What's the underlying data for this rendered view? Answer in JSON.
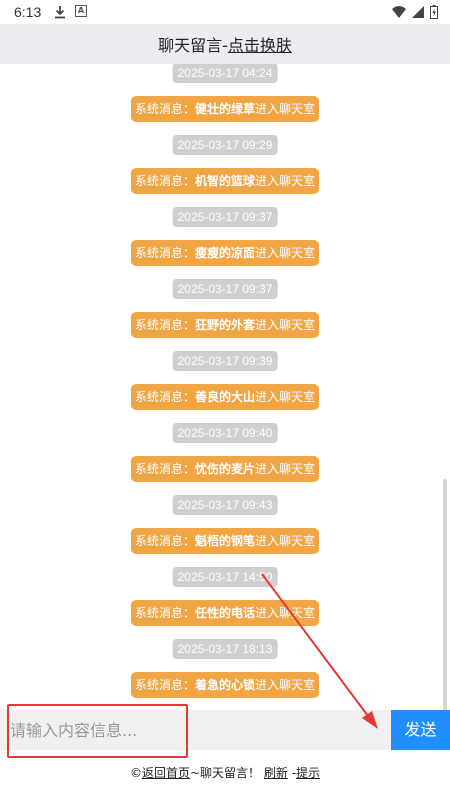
{
  "status_bar": {
    "time": "6:13"
  },
  "header": {
    "title": "聊天留言-",
    "skin_link": "点击换肤"
  },
  "messages": [
    {
      "time": "2025-03-17 04:24",
      "prefix": "系统消息：",
      "nick": "健壮的绿草",
      "suffix": "进入聊天室"
    },
    {
      "time": "2025-03-17 09:29",
      "prefix": "系统消息：",
      "nick": "机智的篮球",
      "suffix": "进入聊天室"
    },
    {
      "time": "2025-03-17 09:37",
      "prefix": "系统消息：",
      "nick": "瘦瘦的凉面",
      "suffix": "进入聊天室"
    },
    {
      "time": "2025-03-17 09:37",
      "prefix": "系统消息：",
      "nick": "狂野的外套",
      "suffix": "进入聊天室"
    },
    {
      "time": "2025-03-17 09:39",
      "prefix": "系统消息：",
      "nick": "善良的大山",
      "suffix": "进入聊天室"
    },
    {
      "time": "2025-03-17 09:40",
      "prefix": "系统消息：",
      "nick": "忧伤的麦片",
      "suffix": "进入聊天室"
    },
    {
      "time": "2025-03-17 09:43",
      "prefix": "系统消息：",
      "nick": "魁梧的钢笔",
      "suffix": "进入聊天室"
    },
    {
      "time": "2025-03-17 14:50",
      "prefix": "系统消息：",
      "nick": "任性的电话",
      "suffix": "进入聊天室"
    },
    {
      "time": "2025-03-17 18:13",
      "prefix": "系统消息：",
      "nick": "着急的心锁",
      "suffix": "进入聊天室"
    }
  ],
  "input": {
    "placeholder": "请输入内容信息...",
    "value": ""
  },
  "send_button": {
    "label": "发送"
  },
  "footer": {
    "copyright": "©",
    "back_home": "返回首页",
    "middle": "~聊天留言！",
    "refresh": "刷新",
    "sep": " -",
    "tips": "提示"
  },
  "colors": {
    "system_bubble": "#f0a645",
    "time_pill": "#cfcfcf",
    "send_button": "#1f8fff",
    "header_bg": "#ebedf0",
    "annotation_red": "#e53935"
  }
}
